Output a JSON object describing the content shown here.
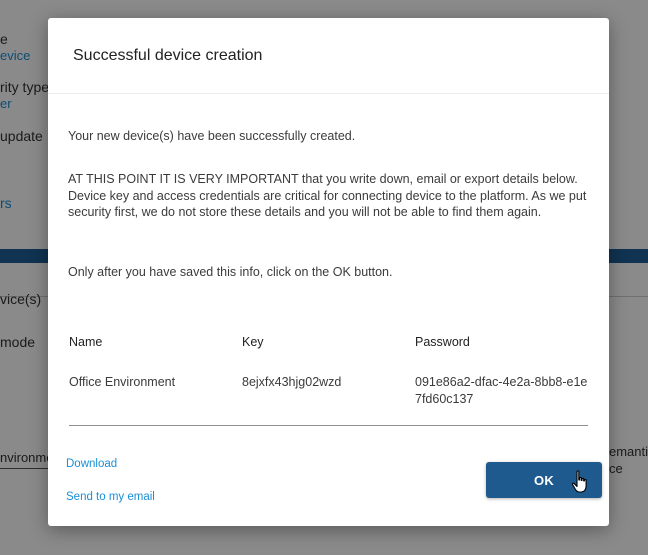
{
  "background": {
    "fragments": {
      "f1": "e",
      "f2": "evice",
      "f3": "rity type",
      "f4": "er",
      "f5": "update",
      "f6": "rs",
      "f7": "vice(s)",
      "f8": "mode",
      "f9": "nvironme",
      "f10": "emantic",
      "f11": "ce"
    }
  },
  "dialog": {
    "title": "Successful device creation",
    "intro": "Your new device(s) have been successfully created.",
    "warning": "AT THIS POINT IT IS VERY IMPORTANT that you write down, email or export details below. Device key and access credentials are critical for connecting device to the platform. As we put security first, we do not store these details and you will not be able to find them again.",
    "instruction": "Only after you have saved this info, click on the OK button.",
    "table": {
      "headers": [
        "Name",
        "Key",
        "Password"
      ],
      "rows": [
        [
          "Office Environment",
          "8ejxfx43hjg02wzd",
          "091e86a2-dfac-4e2a-8bb8-e1e7fd60c137"
        ]
      ]
    },
    "download_label": "Download",
    "email_label": "Send to my email",
    "ok_label": "OK"
  },
  "colors": {
    "accent": "#1f5a8f",
    "link": "#1a8fd6"
  },
  "icons": {
    "cursor": "hand-pointer-icon"
  }
}
